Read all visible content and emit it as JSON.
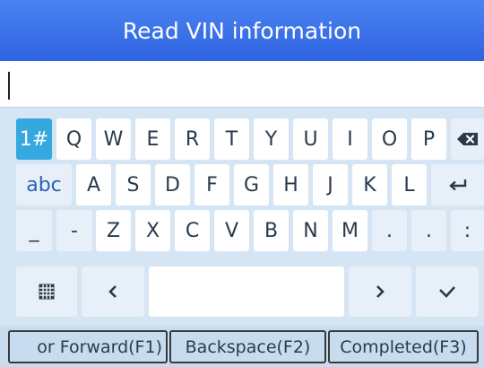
{
  "header": {
    "title": "Read VIN information"
  },
  "input": {
    "value": ""
  },
  "keyboard": {
    "row1": {
      "mode": "1#",
      "keys": [
        "Q",
        "W",
        "E",
        "R",
        "T",
        "Y",
        "U",
        "I",
        "O",
        "P"
      ]
    },
    "row2": {
      "mode": "abc",
      "keys": [
        "A",
        "S",
        "D",
        "F",
        "G",
        "H",
        "J",
        "K",
        "L"
      ]
    },
    "row3": {
      "keys": [
        "_",
        "-",
        "Z",
        "X",
        "C",
        "V",
        "B",
        "N",
        "M",
        ".",
        ".",
        ":"
      ]
    }
  },
  "icons": {
    "delete": "backspace-icon",
    "enter": "enter-icon",
    "keyboard": "keyboard-icon",
    "left": "chevron-left-icon",
    "right": "chevron-right-icon",
    "done": "check-icon"
  },
  "function_bar": {
    "forward": "or Forward(F1)",
    "backspace": "Backspace(F2)",
    "completed": "Completed(F3)"
  },
  "colors": {
    "header": "#3a72ea",
    "active_key": "#35a8e0",
    "keyboard_bg": "#d6e5f3"
  }
}
